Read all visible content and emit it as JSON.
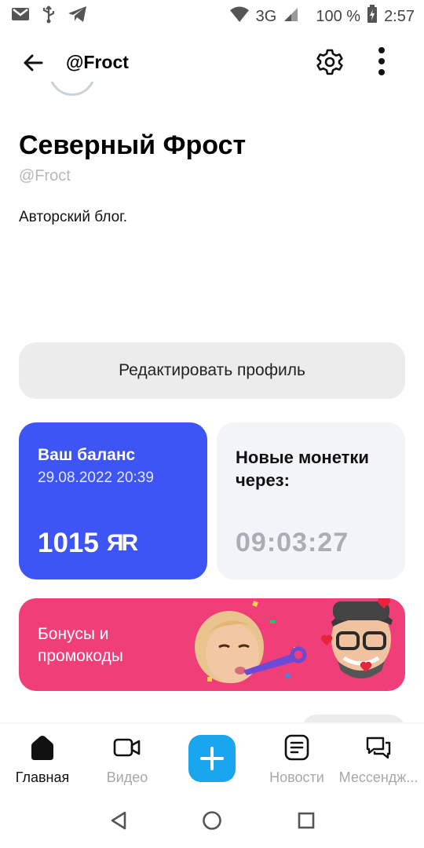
{
  "status_bar": {
    "network": "3G",
    "battery": "100 %",
    "time": "2:57",
    "icons": [
      "gmail-icon",
      "usb-icon",
      "telegram-icon",
      "wifi-icon",
      "signal-icon",
      "battery-charging-icon"
    ]
  },
  "app_bar": {
    "title": "@Froct",
    "icons": [
      "back-arrow-icon",
      "gear-icon",
      "more-vertical-icon"
    ]
  },
  "profile": {
    "name": "Северный Фрост",
    "handle": "@Froct",
    "bio": "Авторский блог."
  },
  "edit_profile_label": "Редактировать профиль",
  "balance_card": {
    "title": "Ваш баланс",
    "date": "29.08.2022 20:39",
    "amount": "1015",
    "currency_symbol": "ЯR",
    "color": "#3e55f5"
  },
  "coins_card": {
    "title": "Новые монетки через:",
    "timer": "09:03:27"
  },
  "bonus_banner": {
    "text": "Бонусы и промокоды",
    "color": "#f03e78"
  },
  "bottom_nav": {
    "items": [
      {
        "label": "Главная",
        "icon": "home-icon",
        "active": true
      },
      {
        "label": "Видео",
        "icon": "video-camera-icon",
        "active": false
      },
      {
        "label": "Новости",
        "icon": "news-icon",
        "active": false
      },
      {
        "label": "Мессендж...",
        "icon": "messenger-icon",
        "active": false
      }
    ],
    "add_icon": "plus-icon",
    "accent": "#1aa6ef"
  },
  "system_nav": [
    "back-triangle-icon",
    "home-circle-icon",
    "recents-square-icon"
  ]
}
